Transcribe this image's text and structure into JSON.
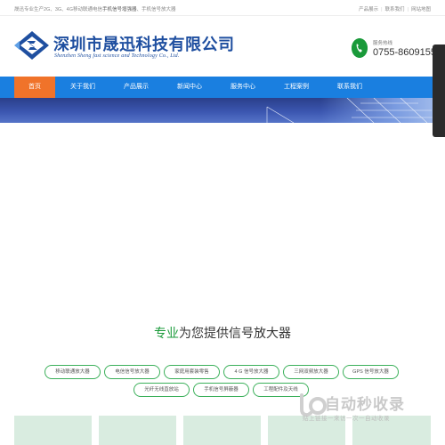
{
  "topbar": {
    "intro_prefix": "晟迅专业生产2G、3G、4G移动联通电信",
    "intro_bold": "手机信号增强器",
    "intro_suffix": "、手机信号放大器",
    "links": [
      "产品展示",
      "联系我们",
      "网站地图"
    ]
  },
  "header": {
    "company_cn": "深圳市晟迅科技有限公司",
    "company_en": "Shenzhen Sheng fast science and Technology Co., Ltd.",
    "hotline_label": "服务热线",
    "hotline_number": "0755-86091552"
  },
  "nav": {
    "items": [
      "首页",
      "关于我们",
      "产品展示",
      "新闻中心",
      "服务中心",
      "工程案例",
      "联系我们"
    ],
    "active_index": 0
  },
  "section": {
    "title_highlight": "专业",
    "title_rest": "为您提供信号放大器"
  },
  "tags": [
    "移动联通放大器",
    "电信信号放大器",
    "家庭用套装零售",
    "4 G 信号放大器",
    "三网双频放大器",
    "GPS 信号放大器",
    "光纤无线直放站",
    "手机信号屏蔽器",
    "工程配件及天线"
  ],
  "watermark": {
    "title": "自动秒收录",
    "subtitle": "贴上链接一来访一次一自动收录"
  },
  "colors": {
    "nav_blue": "#1a7fe0",
    "nav_active": "#f0732a",
    "brand_blue": "#1f4fa0",
    "green": "#1a9a3a"
  }
}
